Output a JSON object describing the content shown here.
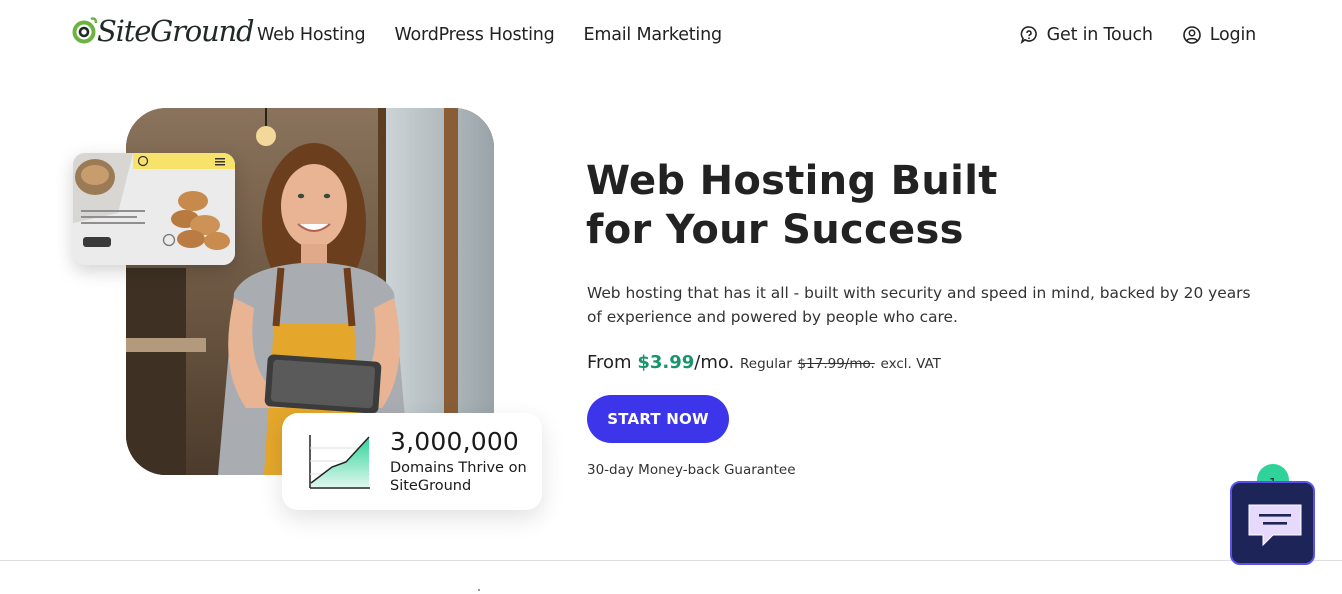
{
  "brand": {
    "logo_text": "SiteGround",
    "accent": "#6db33f"
  },
  "nav": {
    "items": [
      "Web Hosting",
      "WordPress Hosting",
      "Email Marketing"
    ],
    "contact": "Get in Touch",
    "login": "Login"
  },
  "hero": {
    "title_line1": "Web Hosting Built",
    "title_line2": "for Your Success",
    "description": "Web hosting that has it all - built with security and speed in mind, backed by 20 years of experience and powered by people who care.",
    "price_prefix": "From ",
    "price": "$3.99",
    "price_suffix": "/mo.",
    "regular_label": "Regular",
    "regular_price": "$17.99/mo.",
    "vat_note": "excl. VAT",
    "cta": "START NOW",
    "guarantee": "30-day Money-back Guarantee",
    "price_color": "#18956b",
    "cta_color": "#3c35ea"
  },
  "stat": {
    "number": "3,000,000",
    "label": "Domains Thrive on SiteGround"
  },
  "chat": {
    "badge_count": "1",
    "icon": "chat-bubble-icon"
  }
}
